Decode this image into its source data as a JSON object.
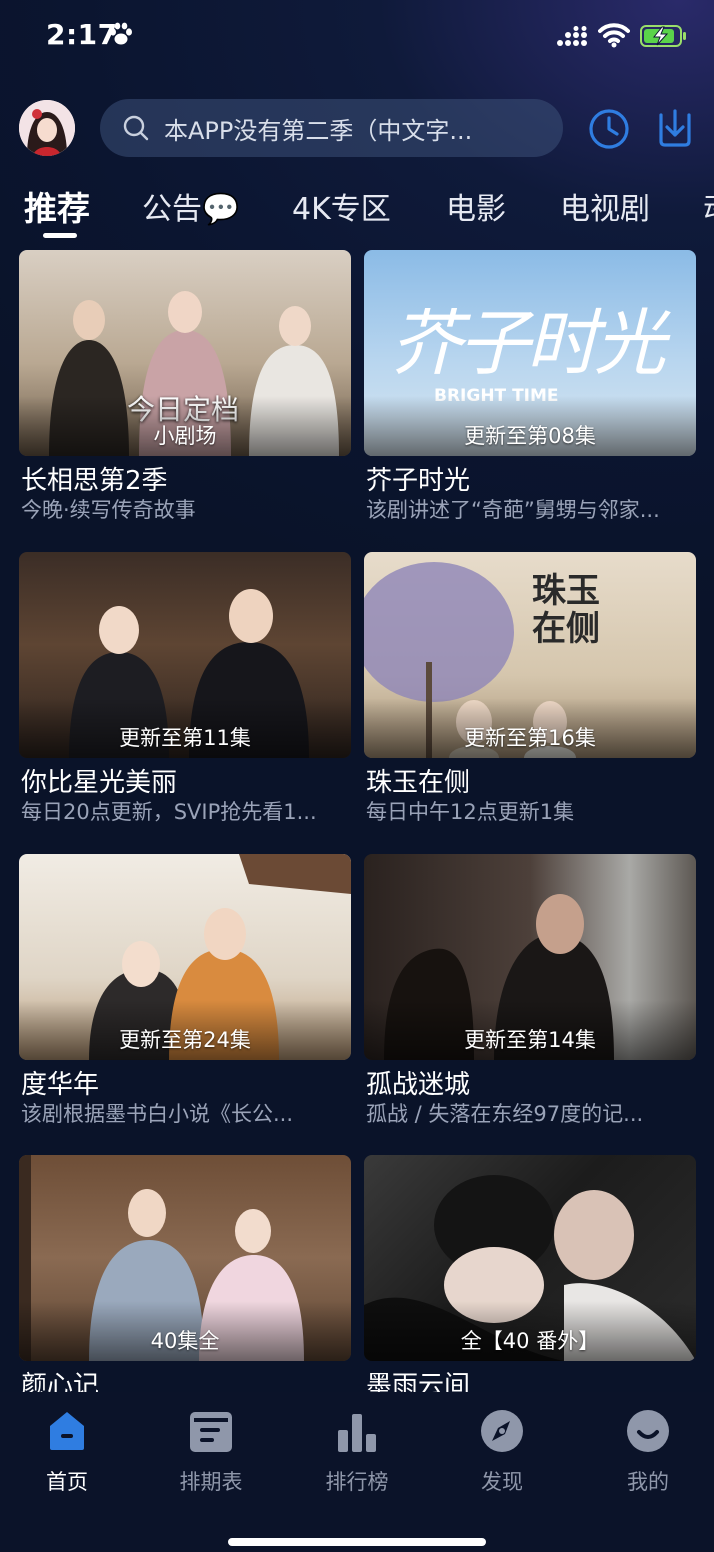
{
  "status_bar": {
    "time": "2:17"
  },
  "header": {
    "search_placeholder": "本APP没有第二季（中文字..."
  },
  "tabs": [
    {
      "label": "推荐",
      "active": true
    },
    {
      "label": "公告💬",
      "active": false
    },
    {
      "label": "4K专区",
      "active": false
    },
    {
      "label": "电影",
      "active": false
    },
    {
      "label": "电视剧",
      "active": false
    },
    {
      "label": "动",
      "active": false
    }
  ],
  "cards": [
    {
      "badge": "小剧场",
      "title": "长相思第2季",
      "subtitle": "今晚·续写传奇故事",
      "poster_text": "今日定档"
    },
    {
      "badge": "更新至第08集",
      "title": "芥子时光",
      "subtitle": "该剧讲述了“奇葩”舅甥与邻家...",
      "poster_text": "芥子时光",
      "poster_sub": "BRIGHT TIME"
    },
    {
      "badge": "更新至第11集",
      "title": "你比星光美丽",
      "subtitle": "每日20点更新，SVIP抢先看1..."
    },
    {
      "badge": "更新至第16集",
      "title": "珠玉在侧",
      "subtitle": "每日中午12点更新1集",
      "poster_text": "珠玉在侧"
    },
    {
      "badge": "更新至第24集",
      "title": "度华年",
      "subtitle": "该剧根据墨书白小说《长公..."
    },
    {
      "badge": "更新至第14集",
      "title": "孤战迷城",
      "subtitle": "孤战 / 失落在东经97度的记..."
    },
    {
      "badge": "40集全",
      "title": "颜心记",
      "subtitle": ""
    },
    {
      "badge": "全【40 番外】",
      "title": "墨雨云间",
      "subtitle": ""
    }
  ],
  "bottom_nav": [
    {
      "label": "首页",
      "icon": "home-icon",
      "active": true
    },
    {
      "label": "排期表",
      "icon": "calendar-icon",
      "active": false
    },
    {
      "label": "排行榜",
      "icon": "ranking-icon",
      "active": false
    },
    {
      "label": "发现",
      "icon": "compass-icon",
      "active": false
    },
    {
      "label": "我的",
      "icon": "profile-icon",
      "active": false
    }
  ],
  "colors": {
    "background": "#0b1530",
    "accent_blue": "#2f7de1",
    "subtitle_gray": "#9aa3b8",
    "nav_inactive": "#8f97aa"
  }
}
